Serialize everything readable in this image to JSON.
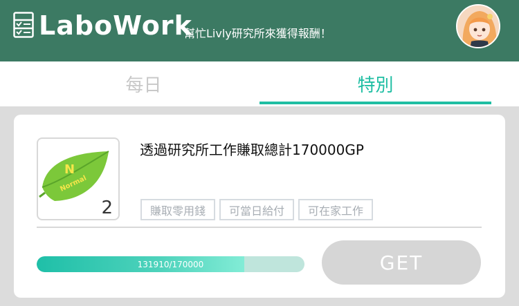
{
  "header": {
    "logo_text": "LaboWork",
    "subtitle": "幫忙Livly研究所來獲得報酬！",
    "icons": {
      "app": "checklist-icon",
      "avatar": "avatar"
    },
    "bg_color": "#3c7a63"
  },
  "tabs": [
    {
      "label": "每日",
      "active": false
    },
    {
      "label": "特別",
      "active": true
    }
  ],
  "task": {
    "title": "透過研究所工作賺取總計170000GP",
    "thumb_badge": "Normal",
    "thumb_count": "2",
    "tags": [
      "賺取零用錢",
      "可當日給付",
      "可在家工作"
    ],
    "progress_text": "131910/170000",
    "progress_fraction": 0.776,
    "get_label": "GET"
  },
  "colors": {
    "accent": "#1fbea3",
    "disabled": "#d6d6d6"
  }
}
